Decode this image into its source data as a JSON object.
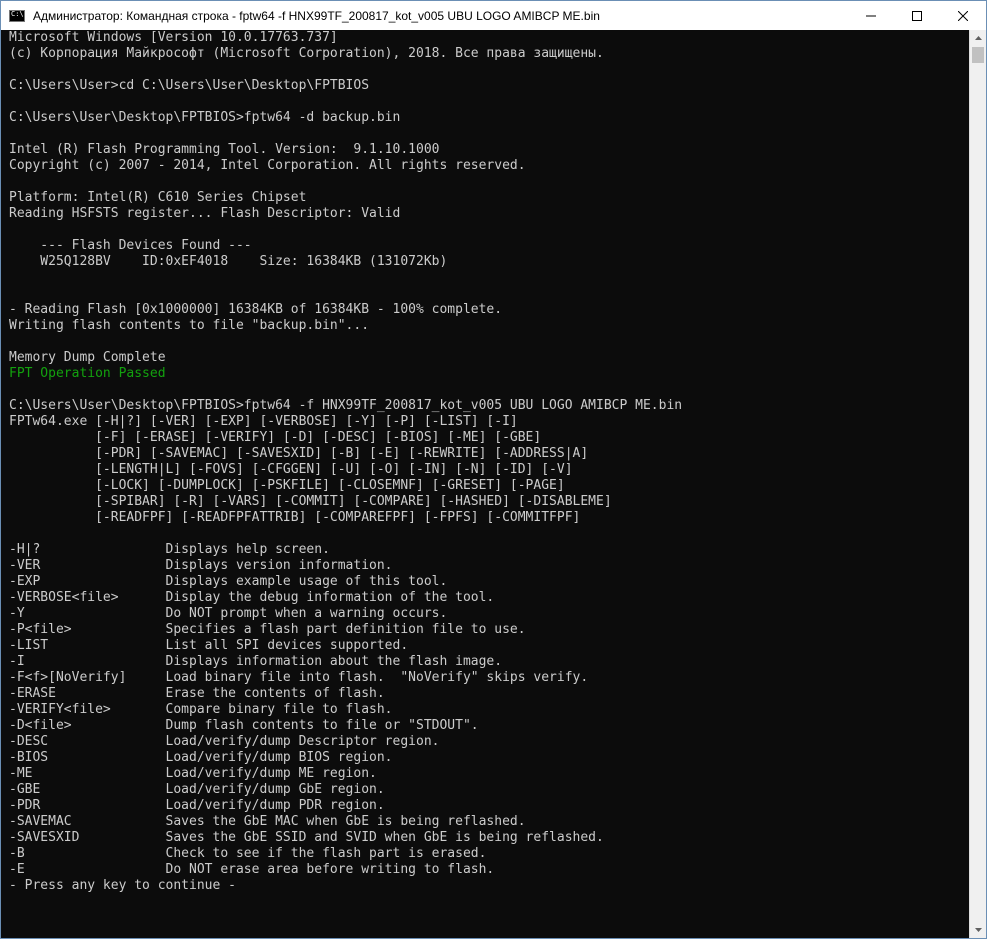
{
  "window": {
    "title": "Администратор: Командная строка - fptw64  -f HNX99TF_200817_kot_v005 UBU LOGO AMIBCP ME.bin",
    "icon": "cmd-icon",
    "controls": [
      "minimize-icon",
      "maximize-icon",
      "close-icon"
    ],
    "text_color": "#cccccc",
    "success_color": "#13a10e",
    "background_color": "#0c0c0c"
  },
  "terminal": {
    "lines": [
      {
        "text": "Microsoft Windows [Version 10.0.17763.737]"
      },
      {
        "text": "(c) Корпорация Майкрософт (Microsoft Corporation), 2018. Все права защищены."
      },
      {
        "text": ""
      },
      {
        "text": "C:\\Users\\User>cd C:\\Users\\User\\Desktop\\FPTBIOS"
      },
      {
        "text": ""
      },
      {
        "text": "C:\\Users\\User\\Desktop\\FPTBIOS>fptw64 -d backup.bin"
      },
      {
        "text": ""
      },
      {
        "text": "Intel (R) Flash Programming Tool. Version:  9.1.10.1000"
      },
      {
        "text": "Copyright (c) 2007 - 2014, Intel Corporation. All rights reserved."
      },
      {
        "text": ""
      },
      {
        "text": "Platform: Intel(R) C610 Series Chipset"
      },
      {
        "text": "Reading HSFSTS register... Flash Descriptor: Valid"
      },
      {
        "text": ""
      },
      {
        "text": "    --- Flash Devices Found ---"
      },
      {
        "text": "    W25Q128BV    ID:0xEF4018    Size: 16384KB (131072Kb)"
      },
      {
        "text": ""
      },
      {
        "text": ""
      },
      {
        "text": "- Reading Flash [0x1000000] 16384KB of 16384KB - 100% complete."
      },
      {
        "text": "Writing flash contents to file \"backup.bin\"..."
      },
      {
        "text": ""
      },
      {
        "text": "Memory Dump Complete"
      },
      {
        "text": "FPT Operation Passed",
        "color": "green"
      },
      {
        "text": ""
      },
      {
        "text": "C:\\Users\\User\\Desktop\\FPTBIOS>fptw64 -f HNX99TF_200817_kot_v005 UBU LOGO AMIBCP ME.bin"
      },
      {
        "text": "FPTw64.exe [-H|?] [-VER] [-EXP] [-VERBOSE] [-Y] [-P] [-LIST] [-I]"
      },
      {
        "text": "           [-F] [-ERASE] [-VERIFY] [-D] [-DESC] [-BIOS] [-ME] [-GBE]"
      },
      {
        "text": "           [-PDR] [-SAVEMAC] [-SAVESXID] [-B] [-E] [-REWRITE] [-ADDRESS|A]"
      },
      {
        "text": "           [-LENGTH|L] [-FOVS] [-CFGGEN] [-U] [-O] [-IN] [-N] [-ID] [-V]"
      },
      {
        "text": "           [-LOCK] [-DUMPLOCK] [-PSKFILE] [-CLOSEMNF] [-GRESET] [-PAGE]"
      },
      {
        "text": "           [-SPIBAR] [-R] [-VARS] [-COMMIT] [-COMPARE] [-HASHED] [-DISABLEME]"
      },
      {
        "text": "           [-READFPF] [-READFPFATTRIB] [-COMPAREFPF] [-FPFS] [-COMMITFPF]"
      },
      {
        "text": ""
      },
      {
        "text": "-H|?                Displays help screen."
      },
      {
        "text": "-VER                Displays version information."
      },
      {
        "text": "-EXP                Displays example usage of this tool."
      },
      {
        "text": "-VERBOSE<file>      Display the debug information of the tool."
      },
      {
        "text": "-Y                  Do NOT prompt when a warning occurs."
      },
      {
        "text": "-P<file>            Specifies a flash part definition file to use."
      },
      {
        "text": "-LIST               List all SPI devices supported."
      },
      {
        "text": "-I                  Displays information about the flash image."
      },
      {
        "text": "-F<f>[NoVerify]     Load binary file into flash.  \"NoVerify\" skips verify."
      },
      {
        "text": "-ERASE              Erase the contents of flash."
      },
      {
        "text": "-VERIFY<file>       Compare binary file to flash."
      },
      {
        "text": "-D<file>            Dump flash contents to file or \"STDOUT\"."
      },
      {
        "text": "-DESC               Load/verify/dump Descriptor region."
      },
      {
        "text": "-BIOS               Load/verify/dump BIOS region."
      },
      {
        "text": "-ME                 Load/verify/dump ME region."
      },
      {
        "text": "-GBE                Load/verify/dump GbE region."
      },
      {
        "text": "-PDR                Load/verify/dump PDR region."
      },
      {
        "text": "-SAVEMAC            Saves the GbE MAC when GbE is being reflashed."
      },
      {
        "text": "-SAVESXID           Saves the GbE SSID and SVID when GbE is being reflashed."
      },
      {
        "text": "-B                  Check to see if the flash part is erased."
      },
      {
        "text": "-E                  Do NOT erase area before writing to flash."
      },
      {
        "text": "- Press any key to continue -"
      }
    ]
  },
  "scrollbar": {
    "up_icon": "scroll-up-arrow-icon",
    "down_icon": "scroll-down-arrow-icon"
  }
}
